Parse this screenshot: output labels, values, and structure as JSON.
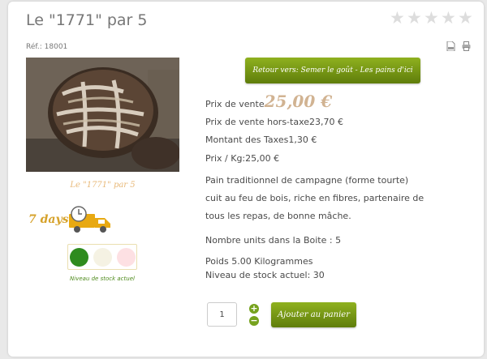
{
  "product": {
    "title": "Le \"1771\" par 5",
    "ref": "Réf.: 18001",
    "caption": "Le \"1771\" par 5",
    "rating": {
      "value": 0,
      "max": 5
    }
  },
  "delivery": {
    "label": "7 days"
  },
  "stock": {
    "label": "Niveau de stock actuel",
    "colors": [
      "#2e8b1e",
      "#f5f2e3",
      "#fde0e3"
    ]
  },
  "actions": {
    "back_label": "Retour vers: Semer le goût - Les pains d'ici",
    "quantity": "1",
    "add_to_cart_label": "Ajouter au panier"
  },
  "pricing": {
    "sale_label": "Prix de vente",
    "sale_value": "25,00 €",
    "ht_label": "Prix de vente hors-taxe",
    "ht_value": "23,70 €",
    "tax_label": "Montant des Taxes",
    "tax_value": "1,30 €",
    "kg_label": "Prix / Kg:",
    "kg_value": "25,00 €"
  },
  "description": "Pain traditionnel de campagne (forme tourte) cuit au feu de bois, riche en fibres, partenaire de tous les repas, de bonne mâche.",
  "details": {
    "units": "Nombre units dans la Boite : 5",
    "weight": "Poids 5.00 Kilogrammes",
    "stock_level": "Niveau de stock actuel: 30"
  },
  "accent_colors": {
    "green": "#6f8f12",
    "price": "#d1b392",
    "caption": "#e8b979"
  }
}
